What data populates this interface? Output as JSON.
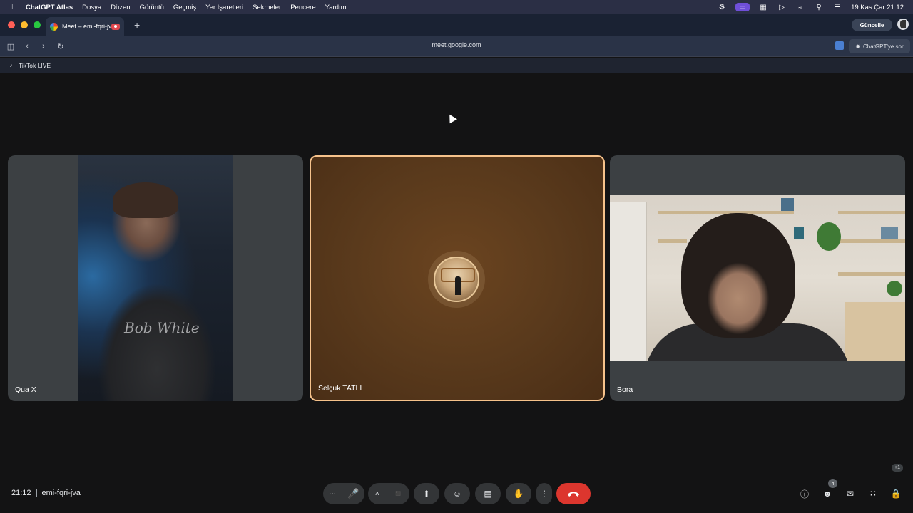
{
  "menubar": {
    "app_name": "ChatGPT Atlas",
    "items": [
      "Dosya",
      "Düzen",
      "Görüntü",
      "Geçmiş",
      "Yer İşaretleri",
      "Sekmeler",
      "Pencere",
      "Yardım"
    ],
    "datetime": "19 Kas Çar  21:12"
  },
  "browser": {
    "tab_title": "Meet – emi-fqri-jva",
    "update_label": "Güncelle",
    "url": "meet.google.com",
    "ask_label": "ChatGPT'ye sor",
    "bookmark": "TikTok LIVE"
  },
  "meet": {
    "participants": [
      {
        "name": "Qua X"
      },
      {
        "name": "Selçuk TATLI",
        "speaking": true
      },
      {
        "name": "Bora"
      }
    ],
    "time": "21:12",
    "meeting_code": "emi-fqri-jva",
    "participant_count": "4",
    "overflow_badge": "+1",
    "shirt_text": "Bob White"
  },
  "colors": {
    "leave": "#dc362e",
    "active_speaker_border": "#f6c28b",
    "control_bg": "#333537"
  }
}
